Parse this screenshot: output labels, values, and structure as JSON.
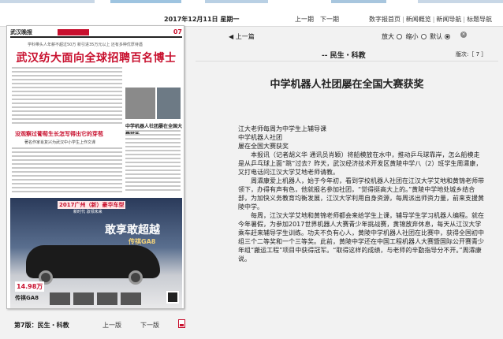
{
  "header": {
    "date": "2017年12月11日",
    "weekday": "星期一",
    "prev_issue": "上一期",
    "next_issue": "下一期",
    "links": [
      "数字报首页",
      "新闻概览",
      "新闻导航",
      "标题导航"
    ]
  },
  "thumbnail": {
    "masthead": "武汉晚报",
    "page_no": "07",
    "strap": "学科带头人年薪不超过50万  新引进35万元以上  还有多种优厚待遇",
    "headline": "武汉纺大面向全球招聘百名博士",
    "headline2": "没观察过葡萄生长怎写得出它的芽苞",
    "sub2": "著名作家肖复兴为武汉中小学生上作文课",
    "side_title": "中学机器人社团屡在全国大赛获奖",
    "ad": {
      "top": "2017广州（新）豪华车型",
      "top2": "新时代 驭领未来",
      "slogan": "敢享敢超越",
      "model": "传祺GA8",
      "price": "14.98万",
      "brand": "传祺GA8"
    }
  },
  "page_nav": {
    "edition": "第7版：民生・科教",
    "prev_page": "上一版",
    "next_page": "下一版"
  },
  "toolbar": {
    "prev_article": "上一篇",
    "zoom_in": "放大",
    "zoom_out": "缩小",
    "default": "默认"
  },
  "section": {
    "name": "-- 民生・科教",
    "version": "版次:［ 7 ］"
  },
  "article": {
    "title": "中学机器人社团屡在全国大赛获奖",
    "lead": [
      "江大老师每周为中学生上辅导课",
      "中学机器人社团",
      "屡在全国大赛获奖"
    ],
    "paragraphs": [
      "本报讯（记者胡义华 通讯员肖颖）将船模放在水中，推动乒乓球靠岸，怎么船模走是从乒乓球上面“跳”过去？昨天，武汉经济技术开发区黄陵中学八（2）班学生周瀮康，又打电话问江汉大学艾地老师请教。",
      "周瀮康爱上机器人，始于今年初，看到学校机器人社团在江汉大学艾地和黄锦老师带领下，办得有声有色，他就报名参加社团，“觉得挺高大上的。”黄陵中学地处城乡结合部，为加快义务教育均衡发展，江汉大学利用自身资源，每周派出师资力量，前来支援黄陵中学。",
      "每周，江汉大学艾地和黄锦老师都会来给学生上课，辅导学生学习机器人编程。就在今年暑假，为参加2017世界机器人大赛青少年挑战赛，黄锦放弃休息，每天从江汉大学乘车赶来辅导学生训练。功夫不负有心人，黄陵中学机器人社团在比赛中，获得全国初中组三个二等奖和一个三等奖。此前，黄陵中学还在中国工程机器人大赛暨国际公开赛青少年组“搬运工程”项目中获得冠军。“取得这样的成绩，与老师的辛勤指导分不开。”周瀮康说。"
    ]
  }
}
